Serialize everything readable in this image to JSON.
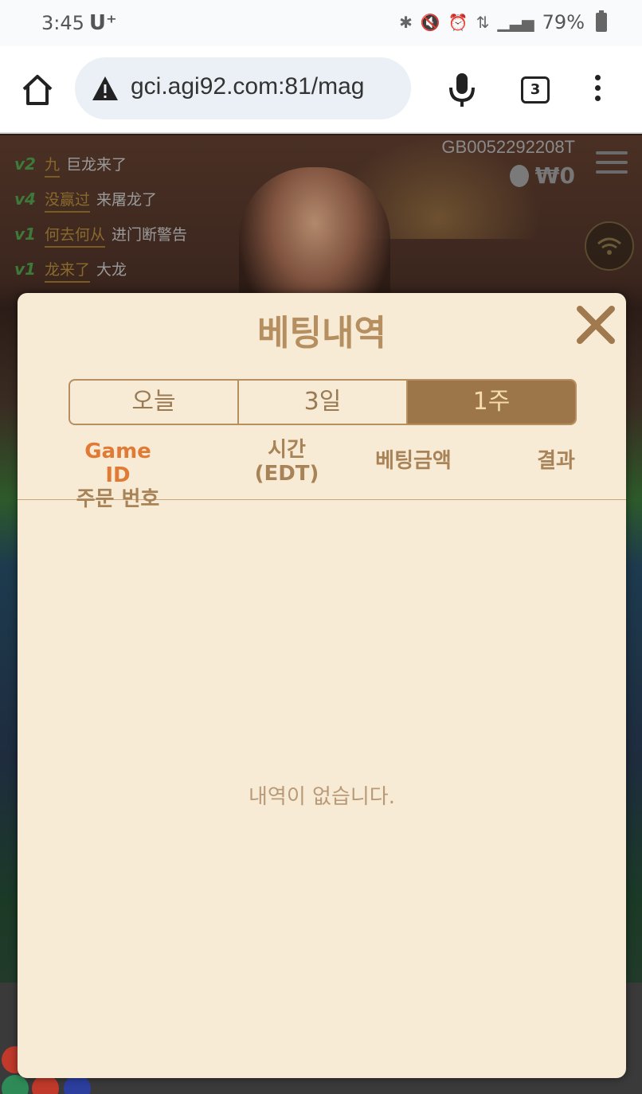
{
  "statusbar": {
    "time": "3:45",
    "carrier": "U⁺",
    "battery": "79%"
  },
  "browser": {
    "url": "gci.agi92.com:81/mag",
    "tab_count": "3"
  },
  "game": {
    "game_id": "GB0052292208T",
    "balance": "₩0",
    "chat": [
      {
        "level": "v2",
        "user": "九",
        "message": "巨龙来了"
      },
      {
        "level": "v4",
        "user": "没赢过",
        "message": "来屠龙了"
      },
      {
        "level": "v1",
        "user": "何去何从",
        "message": "进门断警告"
      },
      {
        "level": "v1",
        "user": "龙来了",
        "message": "大龙"
      }
    ]
  },
  "modal": {
    "title": "베팅내역",
    "tabs": [
      {
        "label": "오늘",
        "active": false
      },
      {
        "label": "3일",
        "active": false
      },
      {
        "label": "1주",
        "active": true
      }
    ],
    "columns": {
      "game_id": "Game ID",
      "order_no": "주문 번호",
      "time": "시간",
      "time_zone": "(EDT)",
      "bet_amount": "베팅금액",
      "result": "결과"
    },
    "empty_message": "내역이 없습니다."
  },
  "colors": {
    "modal_bg": "#f8ebd6",
    "accent": "#b68f61",
    "active_tab": "#9c7548",
    "game_id_header": "#e07a35"
  }
}
